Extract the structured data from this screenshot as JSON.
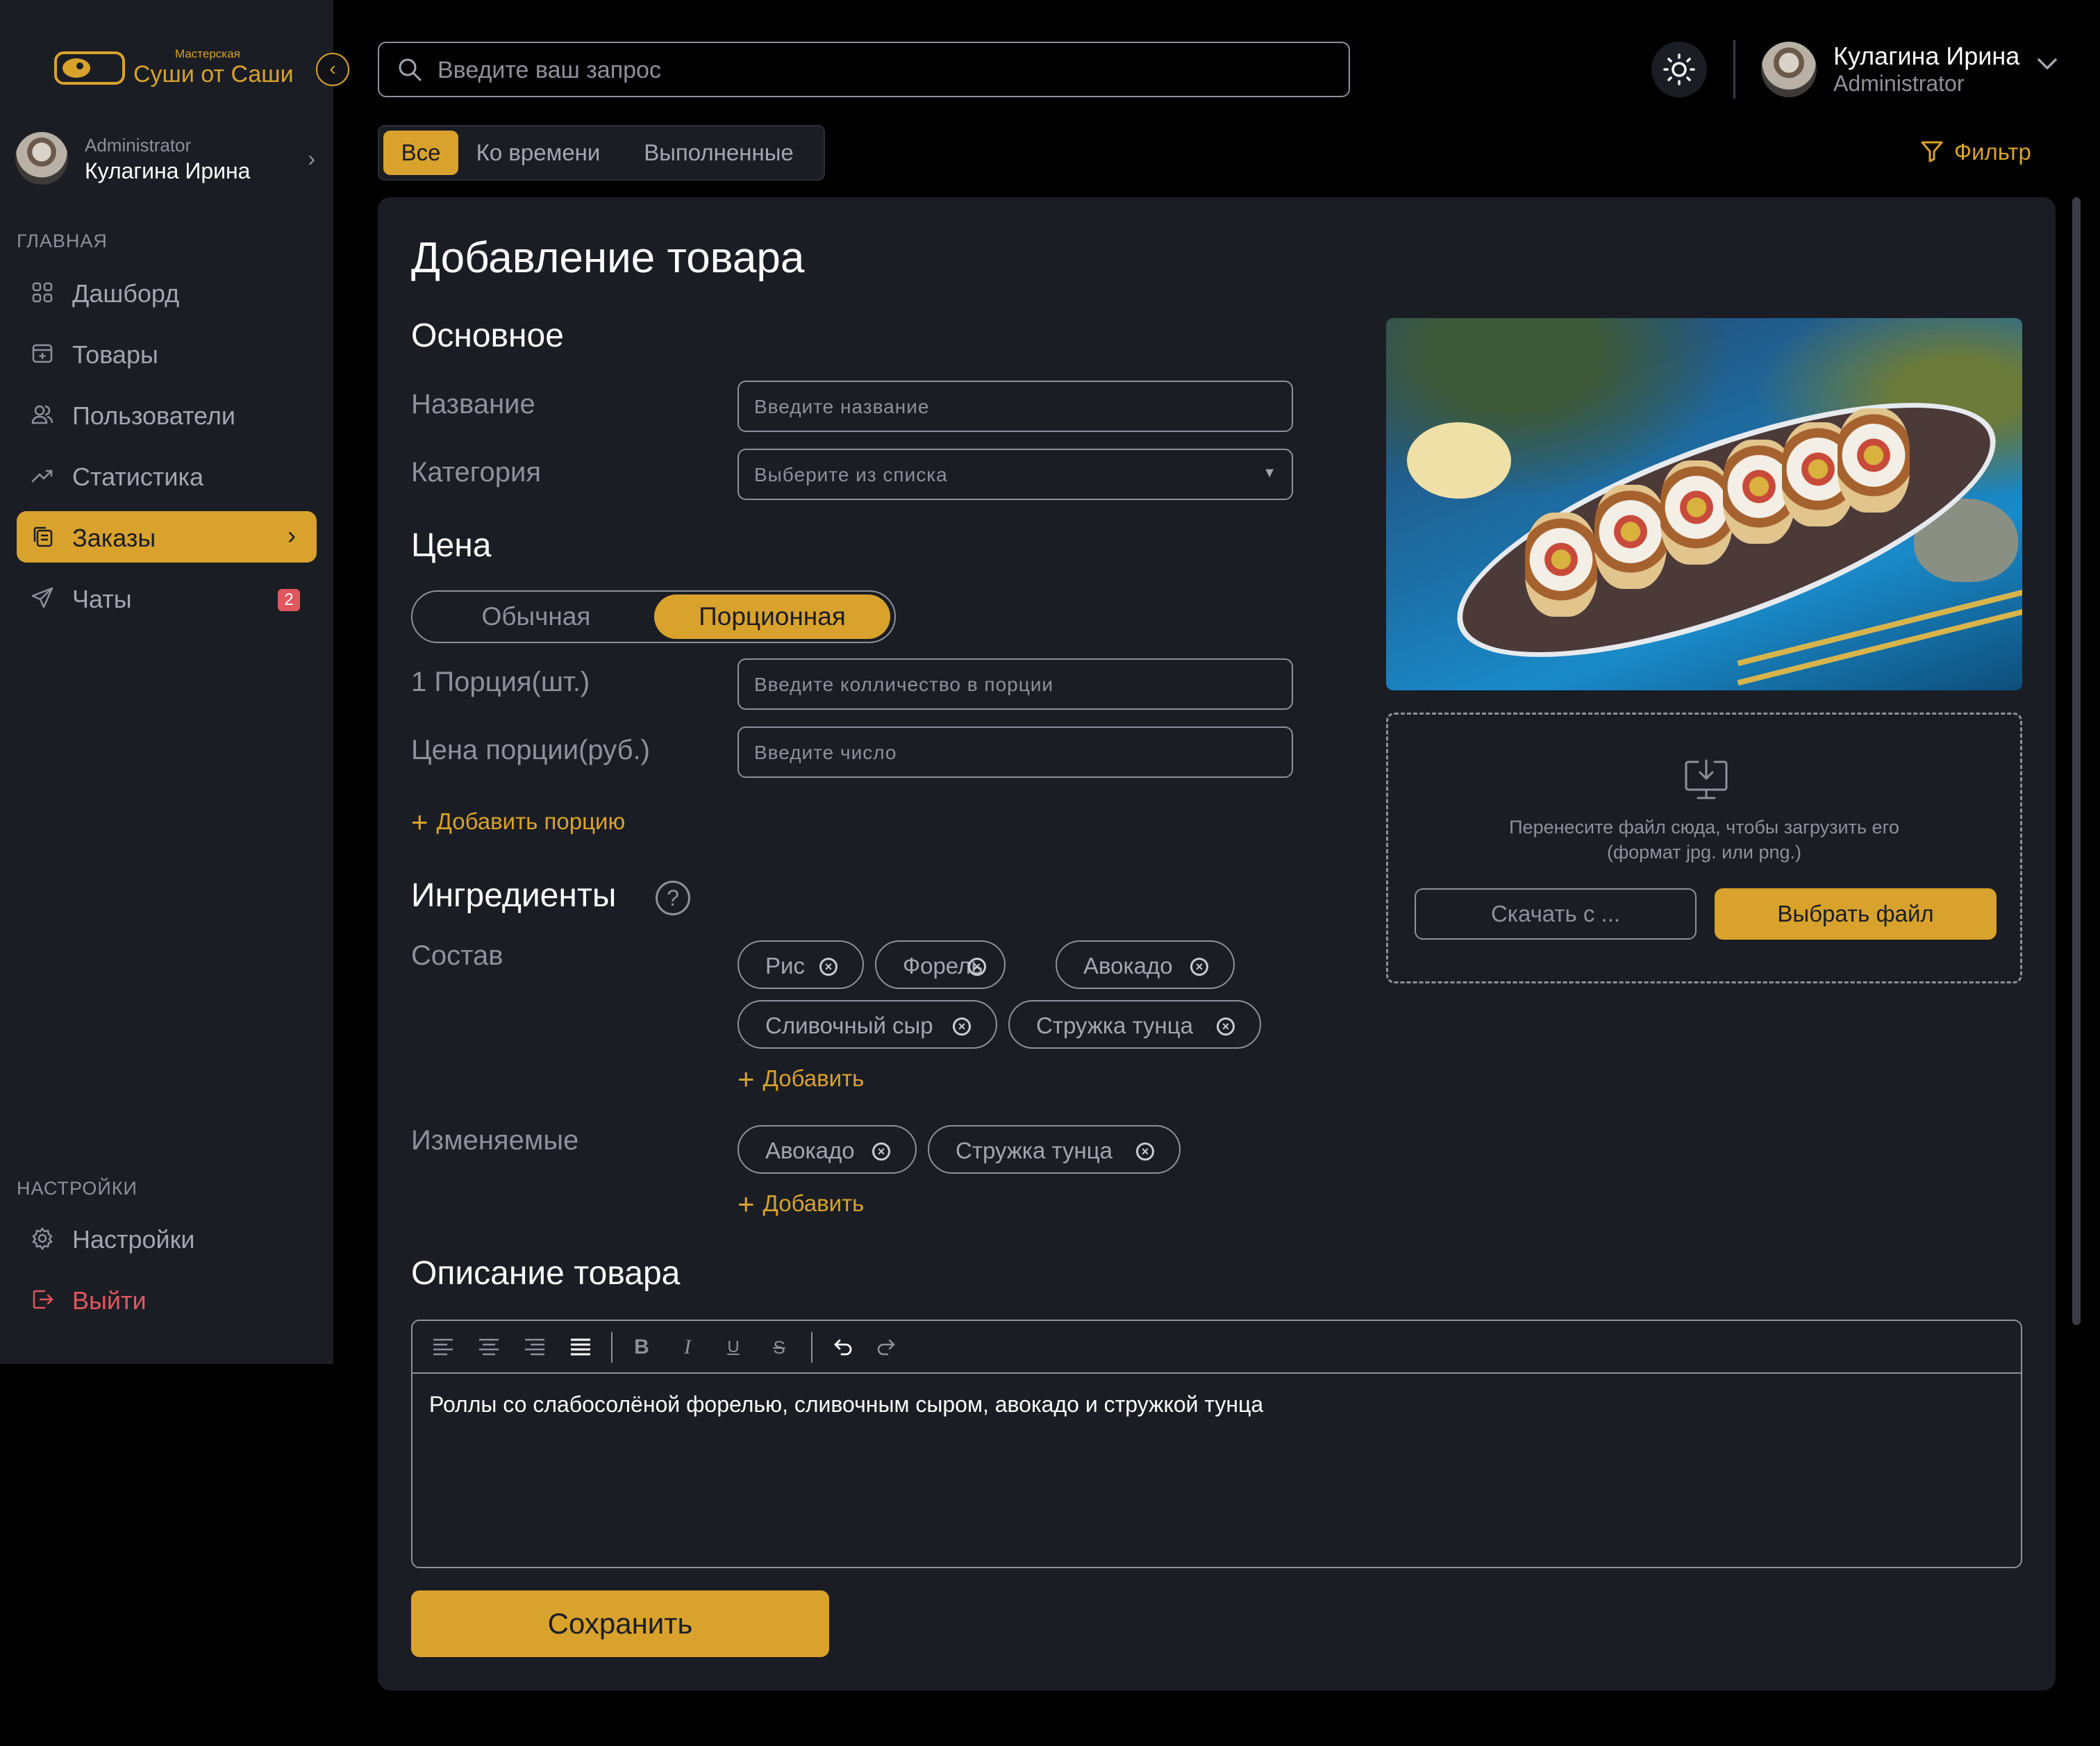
{
  "brand": {
    "small": "Мастерская",
    "name": "Суши от Саши"
  },
  "sidebar": {
    "user": {
      "role": "Administrator",
      "name": "Кулагина Ирина"
    },
    "section_main": "ГЛАВНАЯ",
    "items": [
      {
        "label": "Дашборд",
        "icon": "grid-icon"
      },
      {
        "label": "Товары",
        "icon": "box-plus-icon"
      },
      {
        "label": "Пользователи",
        "icon": "users-icon"
      },
      {
        "label": "Статистика",
        "icon": "trend-icon"
      },
      {
        "label": "Заказы",
        "icon": "orders-icon",
        "active": true
      },
      {
        "label": "Чаты",
        "icon": "send-icon",
        "badge": "2"
      }
    ],
    "section_settings": "НАСТРОЙКИ",
    "settings": {
      "label": "Настройки",
      "icon": "gear-icon"
    },
    "logout": {
      "label": "Выйти",
      "icon": "logout-icon"
    }
  },
  "header": {
    "search_placeholder": "Введите ваш запрос",
    "user": {
      "name": "Кулагина Ирина",
      "role": "Administrator"
    },
    "tabs": [
      "Все",
      "Ко времени",
      "Выполненные"
    ],
    "filter": "Фильтр"
  },
  "form": {
    "title": "Добавление товара",
    "basic": {
      "heading": "Основное",
      "name_label": "Название",
      "name_placeholder": "Введите название",
      "category_label": "Категория",
      "category_placeholder": "Выберите из списка"
    },
    "price": {
      "heading": "Цена",
      "mode_regular": "Обычная",
      "mode_portion": "Порционная",
      "portion_label": "1 Порция(шт.)",
      "portion_placeholder": "Введите колличество в порции",
      "price_label": "Цена порции(руб.)",
      "price_placeholder": "Введите число",
      "add_portion": "Добавить порцию"
    },
    "ingredients": {
      "heading": "Ингредиенты",
      "help": "?",
      "composition_label": "Состав",
      "composition": [
        "Рис",
        "Форель",
        "Авокадо",
        "Сливочный сыр",
        "Стружка тунца"
      ],
      "add": "Добавить",
      "changeable_label": "Изменяемые",
      "changeable": [
        "Авокадо",
        "Стружка тунца"
      ]
    },
    "description": {
      "heading": "Описание товара",
      "text": "Роллы со слабосолёной форелью, сливочным сыром, авокадо и стружкой тунца"
    },
    "save": "Сохранить",
    "upload": {
      "hint_line1": "Перенесите файл сюда, чтобы загрузить его",
      "hint_line2": "(формат jpg. или png.)",
      "download": "Скачать с ...",
      "choose": "Выбрать файл"
    }
  },
  "colors": {
    "accent": "#d8a22c",
    "danger": "#e1575e",
    "panel": "#1b1d24",
    "muted": "#8e919b"
  }
}
